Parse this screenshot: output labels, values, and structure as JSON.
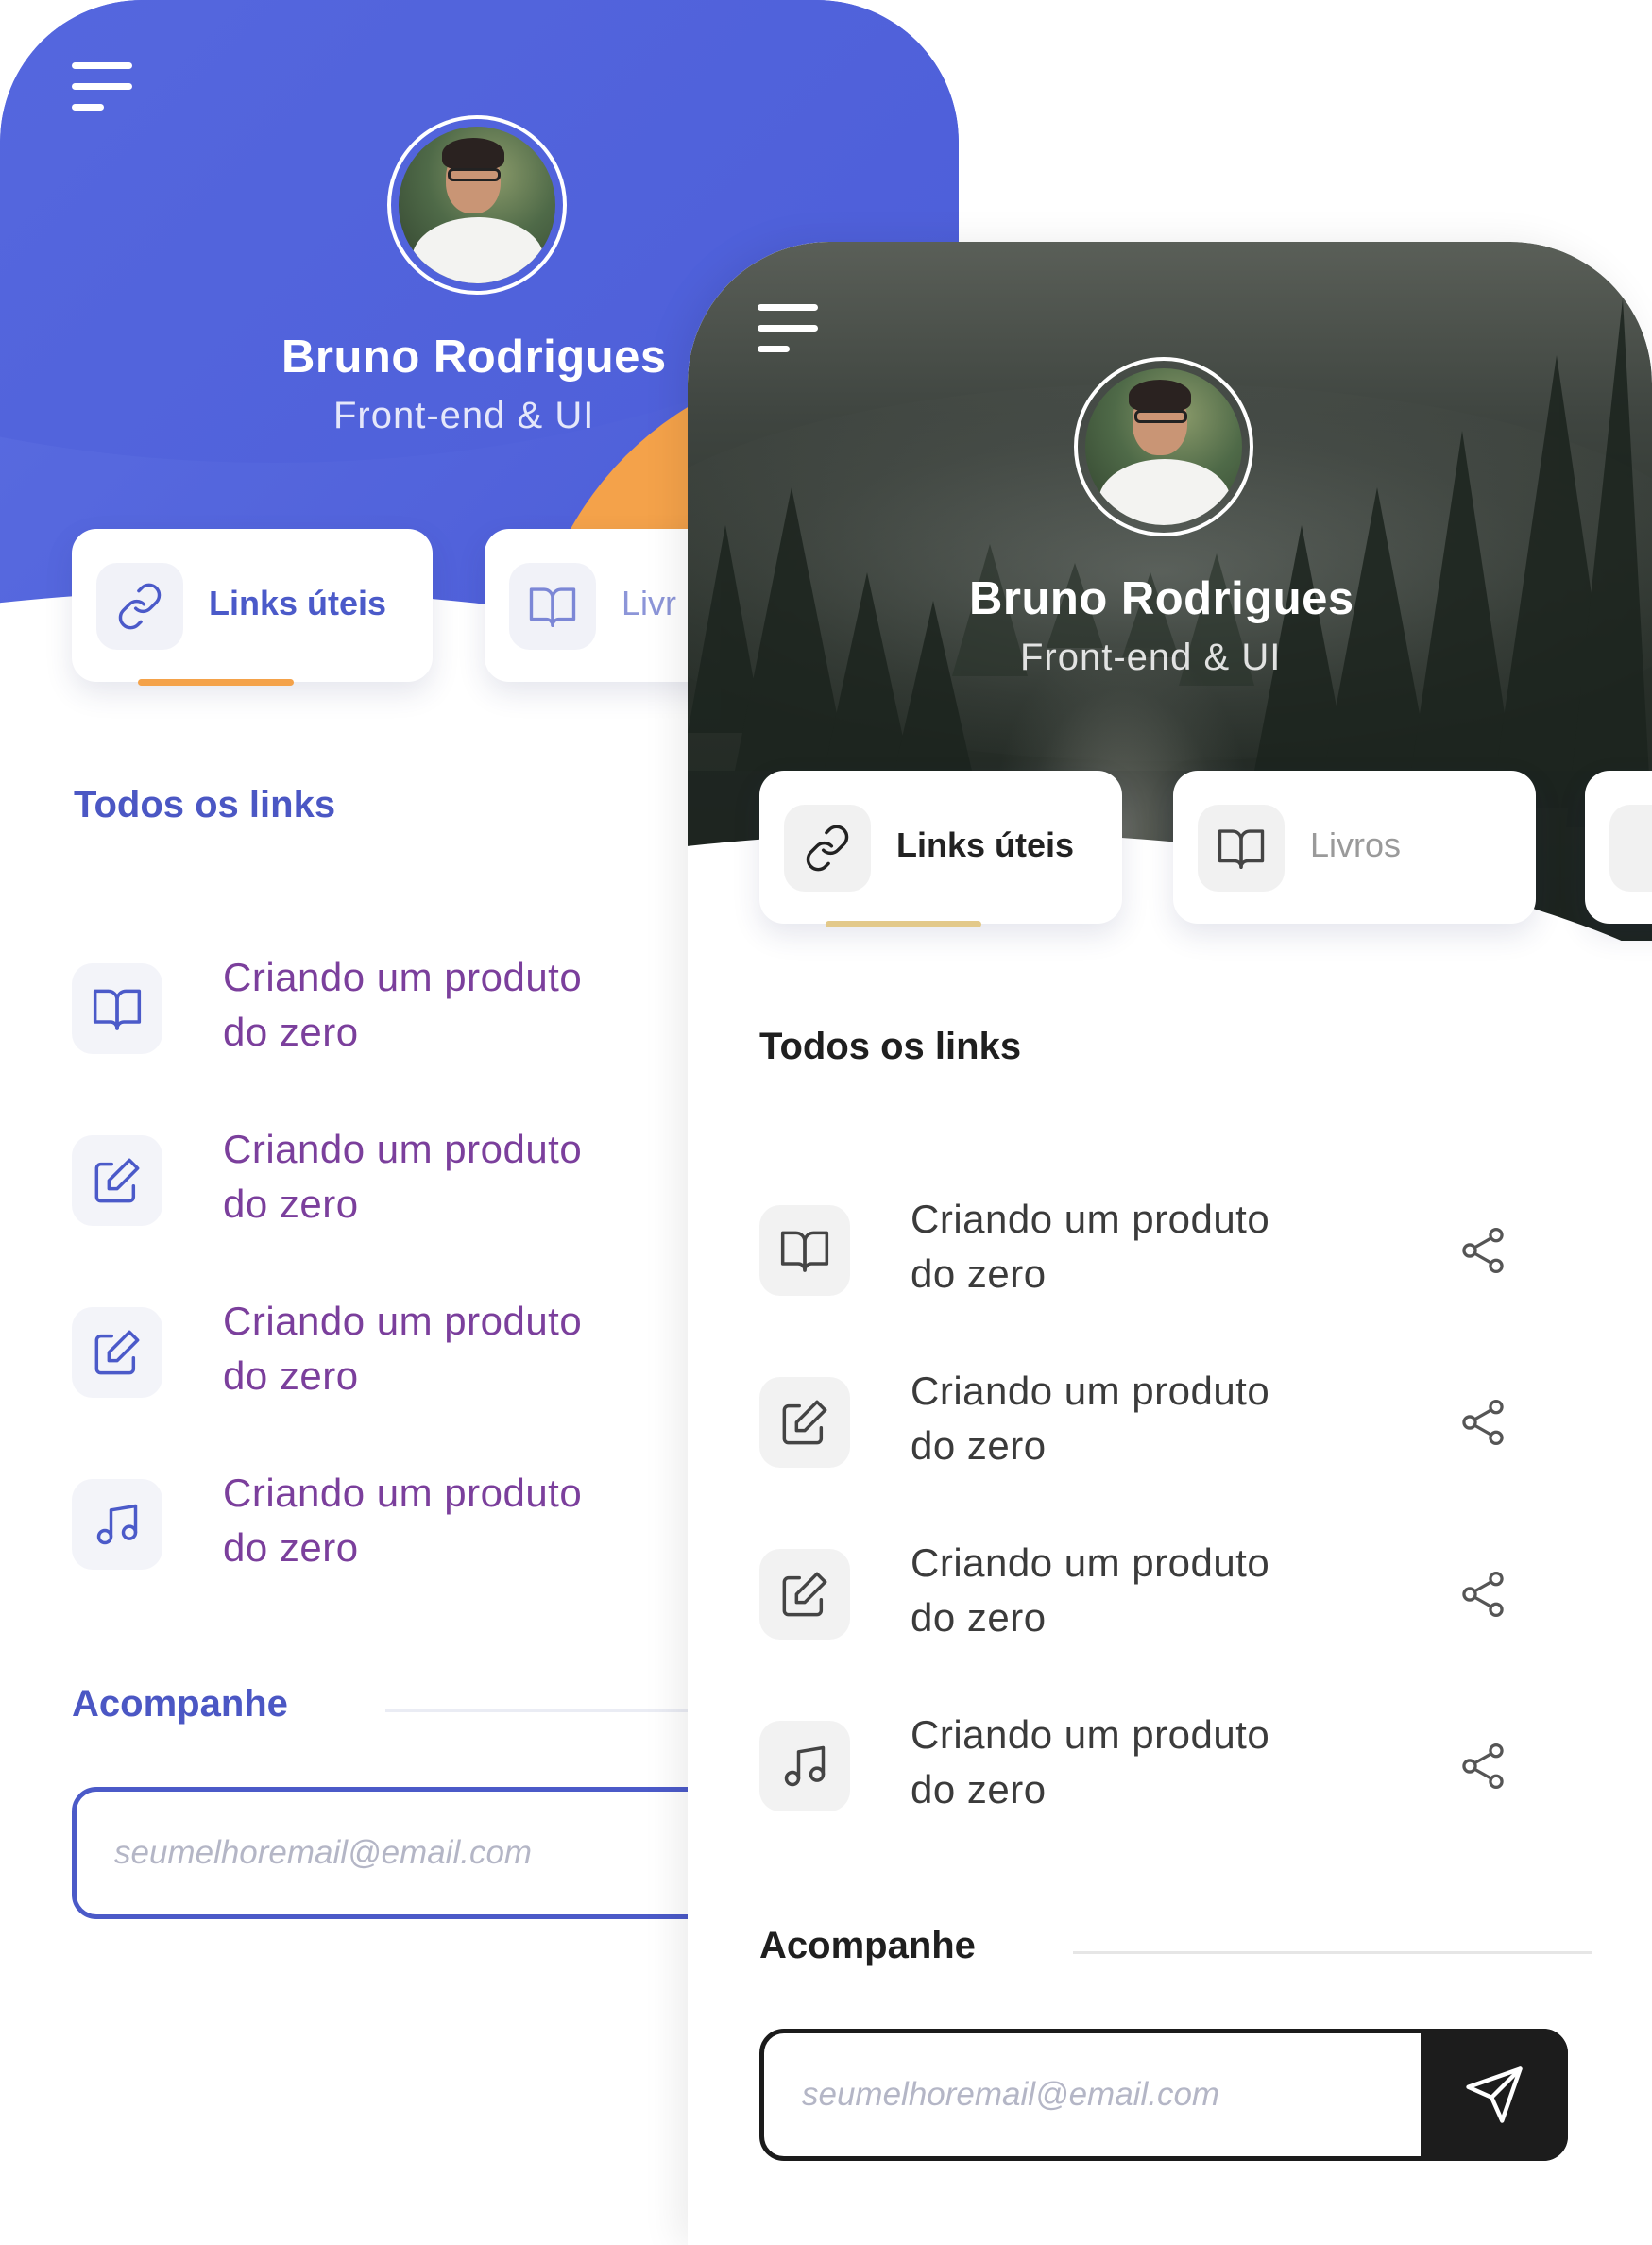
{
  "profile": {
    "name": "Bruno Rodrigues",
    "role": "Front-end & UI"
  },
  "tabs": [
    {
      "label": "Links úteis",
      "icon": "link-icon",
      "active": true
    },
    {
      "label": "Livros",
      "icon": "book-icon",
      "active": false
    }
  ],
  "back_tabs": [
    {
      "label": "Links úteis"
    },
    {
      "label": "Livr"
    }
  ],
  "section_title": "Todos os links",
  "links": [
    {
      "line1": "Criando um produto",
      "line2": "do zero",
      "icon": "book-icon"
    },
    {
      "line1": "Criando um produto",
      "line2": "do zero",
      "icon": "edit-icon"
    },
    {
      "line1": "Criando um produto",
      "line2": "do zero",
      "icon": "edit-icon"
    },
    {
      "line1": "Criando um produto",
      "line2": "do zero",
      "icon": "music-icon"
    }
  ],
  "follow": {
    "title": "Acompanhe",
    "email_placeholder": "seumelhoremail@email.com"
  },
  "colors": {
    "blue_theme": "#4f61db",
    "orange_accent": "#f4a24a",
    "purple_text": "#7b3f9c",
    "dark_theme": "#1c1c1c",
    "gold_underline": "#e3c98a"
  }
}
